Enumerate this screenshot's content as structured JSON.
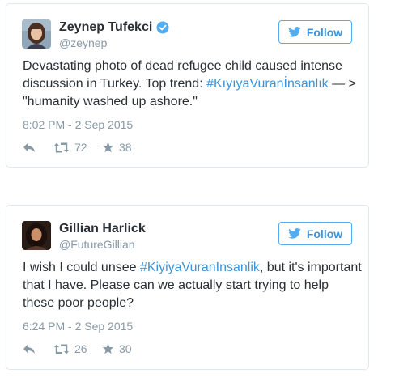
{
  "colors": {
    "accent": "#3b94d9",
    "text": "#292f33",
    "muted": "#8899a6",
    "border": "#e1e8ed"
  },
  "tweets": [
    {
      "name": "Zeynep Tufekci",
      "verified": true,
      "handle": "@zeynep",
      "follow_label": "Follow",
      "text_before": "Devastating photo of dead refugee child caused intense discussion in Turkey. Top trend: ",
      "hashtag": "#KıyıyaVuranİnsanlık",
      "text_after": " — > \"humanity washed up ashore.\"",
      "timestamp": "8:02 PM - 2 Sep 2015",
      "reply_icon": "reply-icon",
      "retweets": "72",
      "favorites": "38"
    },
    {
      "name": "Gillian Harlick",
      "verified": false,
      "handle": "@FutureGillian",
      "follow_label": "Follow",
      "text_before": "I wish I could unsee ",
      "hashtag": "#KiyiyaVuranInsanlik",
      "text_after": ", but it's important that I have. Please can we actually start trying to help these poor people?",
      "timestamp": "6:24 PM - 2 Sep 2015",
      "reply_icon": "reply-icon",
      "retweets": "26",
      "favorites": "30"
    }
  ]
}
